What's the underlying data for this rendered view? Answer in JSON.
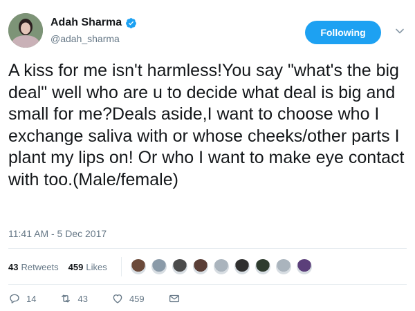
{
  "user": {
    "display_name": "Adah Sharma",
    "handle": "@adah_sharma",
    "verified": true
  },
  "follow_button_label": "Following",
  "tweet_text": "A kiss for me isn't harmless!You say \"what's the big deal\" well who are u to decide what deal is big and small for me?Deals aside,I want to choose who I exchange saliva with or whose cheeks/other parts I plant my lips on! Or who I want to make eye contact with too.(Male/female)",
  "timestamp": "11:41 AM - 5 Dec 2017",
  "stats": {
    "retweets_count": "43",
    "retweets_label": "Retweets",
    "likes_count": "459",
    "likes_label": "Likes"
  },
  "liker_avatars": [
    "#6b4a3a",
    "#8a9aa8",
    "#4a4a4a",
    "#5a3e36",
    "#aab4bd",
    "#2f2f2f",
    "#2e3b2e",
    "#aab4bd",
    "#5b3f7a"
  ],
  "actions": {
    "reply_count": "14",
    "retweet_count": "43",
    "like_count": "459"
  },
  "colors": {
    "accent": "#1da1f2",
    "muted": "#657786",
    "text": "#14171a"
  }
}
